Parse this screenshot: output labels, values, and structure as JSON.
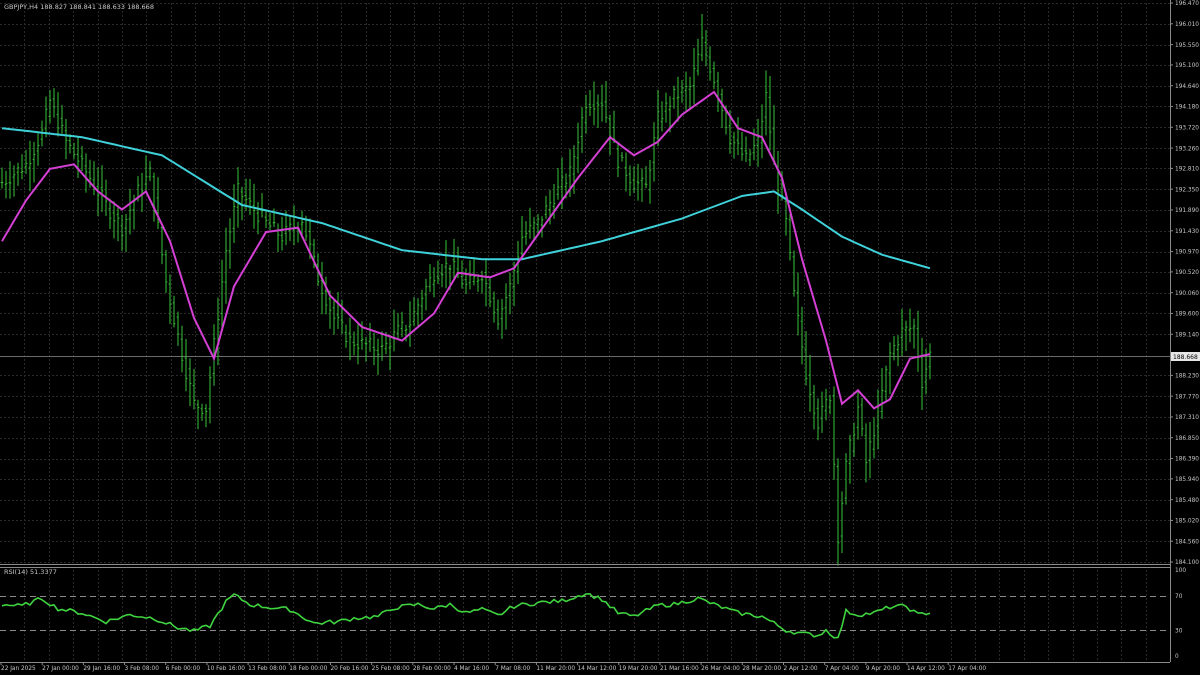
{
  "symbol_info": "GBPJPY,H4  188.827 188.841 188.633 188.668",
  "rsi_info": "RSI(14) 51.3377",
  "current_price_label": "188.668",
  "colors": {
    "background": "#000000",
    "grid": "#2a2a2a",
    "axis_text": "#c8c8c8",
    "bars": "#39c239",
    "ma_fast": "#d43fd4",
    "ma_slow": "#3fd1d9",
    "rsi": "#3fd43f"
  },
  "chart_data": [
    {
      "type": "candlestick",
      "symbol": "GBPJPY",
      "timeframe": "H4",
      "ylim": [
        184.1,
        196.47
      ],
      "y_ticks": [
        "196.470",
        "196.010",
        "195.550",
        "195.100",
        "194.640",
        "194.180",
        "193.720",
        "193.260",
        "192.810",
        "192.350",
        "191.890",
        "191.430",
        "190.970",
        "190.520",
        "190.060",
        "189.600",
        "189.140",
        "188.230",
        "187.770",
        "187.310",
        "186.850",
        "186.390",
        "185.940",
        "185.480",
        "185.020",
        "184.560",
        "184.100"
      ],
      "x_labels": [
        "22 Jan 2025",
        "27 Jan 00:00",
        "29 Jan 16:00",
        "3 Feb 08:00",
        "6 Feb 00:00",
        "10 Feb 16:00",
        "13 Feb 08:00",
        "18 Feb 00:00",
        "20 Feb 16:00",
        "25 Feb 08:00",
        "28 Feb 00:00",
        "4 Mar 16:00",
        "7 Mar 08:00",
        "11 Mar 20:00",
        "14 Mar 12:00",
        "19 Mar 20:00",
        "21 Mar 16:00",
        "26 Mar 04:00",
        "28 Mar 20:00",
        "2 Apr 12:00",
        "7 Apr 04:00",
        "9 Apr 20:00",
        "14 Apr 12:00",
        "17 Apr 04:00"
      ],
      "current_price": 188.668,
      "price_path": [
        {
          "i": 0,
          "p": 192.5
        },
        {
          "i": 6,
          "p": 192.9
        },
        {
          "i": 10,
          "p": 193.6
        },
        {
          "i": 12,
          "p": 194.3
        },
        {
          "i": 16,
          "p": 193.4
        },
        {
          "i": 22,
          "p": 192.6
        },
        {
          "i": 26,
          "p": 192.0
        },
        {
          "i": 30,
          "p": 191.5
        },
        {
          "i": 34,
          "p": 192.3
        },
        {
          "i": 37,
          "p": 192.7
        },
        {
          "i": 41,
          "p": 190.3
        },
        {
          "i": 45,
          "p": 188.7
        },
        {
          "i": 48,
          "p": 187.6
        },
        {
          "i": 51,
          "p": 187.5
        },
        {
          "i": 53,
          "p": 188.9
        },
        {
          "i": 56,
          "p": 191.0
        },
        {
          "i": 59,
          "p": 192.3
        },
        {
          "i": 62,
          "p": 192.0
        },
        {
          "i": 66,
          "p": 191.6
        },
        {
          "i": 70,
          "p": 191.3
        },
        {
          "i": 75,
          "p": 191.7
        },
        {
          "i": 79,
          "p": 190.4
        },
        {
          "i": 83,
          "p": 189.5
        },
        {
          "i": 87,
          "p": 189.0
        },
        {
          "i": 91,
          "p": 188.9
        },
        {
          "i": 95,
          "p": 188.8
        },
        {
          "i": 99,
          "p": 189.2
        },
        {
          "i": 102,
          "p": 189.4
        },
        {
          "i": 105,
          "p": 190.0
        },
        {
          "i": 108,
          "p": 190.5
        },
        {
          "i": 112,
          "p": 190.7
        },
        {
          "i": 116,
          "p": 190.2
        },
        {
          "i": 120,
          "p": 190.5
        },
        {
          "i": 124,
          "p": 189.5
        },
        {
          "i": 127,
          "p": 190.2
        },
        {
          "i": 130,
          "p": 191.3
        },
        {
          "i": 134,
          "p": 191.6
        },
        {
          "i": 138,
          "p": 192.2
        },
        {
          "i": 142,
          "p": 192.7
        },
        {
          "i": 146,
          "p": 194.3
        },
        {
          "i": 150,
          "p": 194.3
        },
        {
          "i": 154,
          "p": 193.0
        },
        {
          "i": 158,
          "p": 192.5
        },
        {
          "i": 161,
          "p": 192.4
        },
        {
          "i": 164,
          "p": 193.9
        },
        {
          "i": 168,
          "p": 194.4
        },
        {
          "i": 172,
          "p": 194.6
        },
        {
          "i": 175,
          "p": 195.6
        },
        {
          "i": 178,
          "p": 194.8
        },
        {
          "i": 182,
          "p": 193.5
        },
        {
          "i": 186,
          "p": 193.0
        },
        {
          "i": 189,
          "p": 193.4
        },
        {
          "i": 191,
          "p": 194.4
        },
        {
          "i": 193,
          "p": 192.9
        },
        {
          "i": 196,
          "p": 191.6
        },
        {
          "i": 198,
          "p": 190.0
        },
        {
          "i": 201,
          "p": 188.3
        },
        {
          "i": 204,
          "p": 187.2
        },
        {
          "i": 207,
          "p": 187.8
        },
        {
          "i": 208,
          "p": 186.3
        },
        {
          "i": 209,
          "p": 184.7
        },
        {
          "i": 211,
          "p": 186.2
        },
        {
          "i": 214,
          "p": 187.5
        },
        {
          "i": 216,
          "p": 186.3
        },
        {
          "i": 219,
          "p": 187.4
        },
        {
          "i": 222,
          "p": 188.7
        },
        {
          "i": 225,
          "p": 189.2
        },
        {
          "i": 228,
          "p": 189.3
        },
        {
          "i": 230,
          "p": 188.1
        },
        {
          "i": 232,
          "p": 188.7
        }
      ],
      "bar_count": 233,
      "series": [
        {
          "values_from": "price_path",
          "role": "bars"
        },
        {
          "values_from": "ma_fast",
          "role": "ma-fast"
        },
        {
          "values_from": "ma_slow",
          "role": "ma-slow"
        }
      ],
      "ma_fast": [
        {
          "i": 0,
          "p": 191.2
        },
        {
          "i": 6,
          "p": 192.1
        },
        {
          "i": 12,
          "p": 192.8
        },
        {
          "i": 18,
          "p": 192.9
        },
        {
          "i": 24,
          "p": 192.3
        },
        {
          "i": 30,
          "p": 191.9
        },
        {
          "i": 36,
          "p": 192.3
        },
        {
          "i": 42,
          "p": 191.2
        },
        {
          "i": 48,
          "p": 189.5
        },
        {
          "i": 53,
          "p": 188.6
        },
        {
          "i": 58,
          "p": 190.2
        },
        {
          "i": 66,
          "p": 191.4
        },
        {
          "i": 74,
          "p": 191.5
        },
        {
          "i": 82,
          "p": 190.0
        },
        {
          "i": 90,
          "p": 189.3
        },
        {
          "i": 100,
          "p": 189.0
        },
        {
          "i": 108,
          "p": 189.6
        },
        {
          "i": 114,
          "p": 190.5
        },
        {
          "i": 122,
          "p": 190.4
        },
        {
          "i": 128,
          "p": 190.6
        },
        {
          "i": 136,
          "p": 191.6
        },
        {
          "i": 144,
          "p": 192.6
        },
        {
          "i": 152,
          "p": 193.5
        },
        {
          "i": 158,
          "p": 193.1
        },
        {
          "i": 164,
          "p": 193.4
        },
        {
          "i": 170,
          "p": 194.0
        },
        {
          "i": 178,
          "p": 194.5
        },
        {
          "i": 184,
          "p": 193.7
        },
        {
          "i": 190,
          "p": 193.5
        },
        {
          "i": 195,
          "p": 192.6
        },
        {
          "i": 200,
          "p": 190.8
        },
        {
          "i": 206,
          "p": 189.0
        },
        {
          "i": 210,
          "p": 187.6
        },
        {
          "i": 214,
          "p": 187.9
        },
        {
          "i": 218,
          "p": 187.5
        },
        {
          "i": 222,
          "p": 187.7
        },
        {
          "i": 227,
          "p": 188.6
        },
        {
          "i": 232,
          "p": 188.7
        }
      ],
      "ma_slow": [
        {
          "i": 0,
          "p": 193.7
        },
        {
          "i": 20,
          "p": 193.5
        },
        {
          "i": 40,
          "p": 193.1
        },
        {
          "i": 60,
          "p": 192.0
        },
        {
          "i": 80,
          "p": 191.6
        },
        {
          "i": 100,
          "p": 191.0
        },
        {
          "i": 120,
          "p": 190.8
        },
        {
          "i": 130,
          "p": 190.8
        },
        {
          "i": 150,
          "p": 191.2
        },
        {
          "i": 170,
          "p": 191.7
        },
        {
          "i": 185,
          "p": 192.2
        },
        {
          "i": 193,
          "p": 192.3
        },
        {
          "i": 200,
          "p": 191.9
        },
        {
          "i": 210,
          "p": 191.3
        },
        {
          "i": 220,
          "p": 190.9
        },
        {
          "i": 232,
          "p": 190.6
        }
      ]
    },
    {
      "type": "line",
      "name": "RSI(14)",
      "ylim": [
        0,
        100
      ],
      "y_ticks": [
        "100",
        "70",
        "30",
        "0"
      ],
      "levels": [
        70,
        30
      ],
      "points": [
        {
          "i": 0,
          "v": 60
        },
        {
          "i": 5,
          "v": 58
        },
        {
          "i": 10,
          "v": 67
        },
        {
          "i": 14,
          "v": 55
        },
        {
          "i": 20,
          "v": 50
        },
        {
          "i": 26,
          "v": 40
        },
        {
          "i": 32,
          "v": 48
        },
        {
          "i": 38,
          "v": 44
        },
        {
          "i": 44,
          "v": 33
        },
        {
          "i": 48,
          "v": 29
        },
        {
          "i": 52,
          "v": 35
        },
        {
          "i": 56,
          "v": 63
        },
        {
          "i": 58,
          "v": 71
        },
        {
          "i": 62,
          "v": 60
        },
        {
          "i": 66,
          "v": 57
        },
        {
          "i": 72,
          "v": 54
        },
        {
          "i": 78,
          "v": 38
        },
        {
          "i": 84,
          "v": 40
        },
        {
          "i": 88,
          "v": 44
        },
        {
          "i": 94,
          "v": 46
        },
        {
          "i": 98,
          "v": 56
        },
        {
          "i": 104,
          "v": 60
        },
        {
          "i": 108,
          "v": 55
        },
        {
          "i": 112,
          "v": 60
        },
        {
          "i": 116,
          "v": 50
        },
        {
          "i": 120,
          "v": 54
        },
        {
          "i": 124,
          "v": 47
        },
        {
          "i": 128,
          "v": 58
        },
        {
          "i": 134,
          "v": 62
        },
        {
          "i": 140,
          "v": 64
        },
        {
          "i": 146,
          "v": 73
        },
        {
          "i": 150,
          "v": 66
        },
        {
          "i": 154,
          "v": 50
        },
        {
          "i": 158,
          "v": 46
        },
        {
          "i": 164,
          "v": 59
        },
        {
          "i": 168,
          "v": 60
        },
        {
          "i": 174,
          "v": 67
        },
        {
          "i": 178,
          "v": 60
        },
        {
          "i": 184,
          "v": 50
        },
        {
          "i": 190,
          "v": 46
        },
        {
          "i": 193,
          "v": 38
        },
        {
          "i": 196,
          "v": 30
        },
        {
          "i": 200,
          "v": 26
        },
        {
          "i": 204,
          "v": 24
        },
        {
          "i": 206,
          "v": 30
        },
        {
          "i": 209,
          "v": 20
        },
        {
          "i": 211,
          "v": 52
        },
        {
          "i": 214,
          "v": 48
        },
        {
          "i": 218,
          "v": 50
        },
        {
          "i": 222,
          "v": 57
        },
        {
          "i": 226,
          "v": 58
        },
        {
          "i": 229,
          "v": 48
        },
        {
          "i": 232,
          "v": 51
        }
      ]
    }
  ]
}
